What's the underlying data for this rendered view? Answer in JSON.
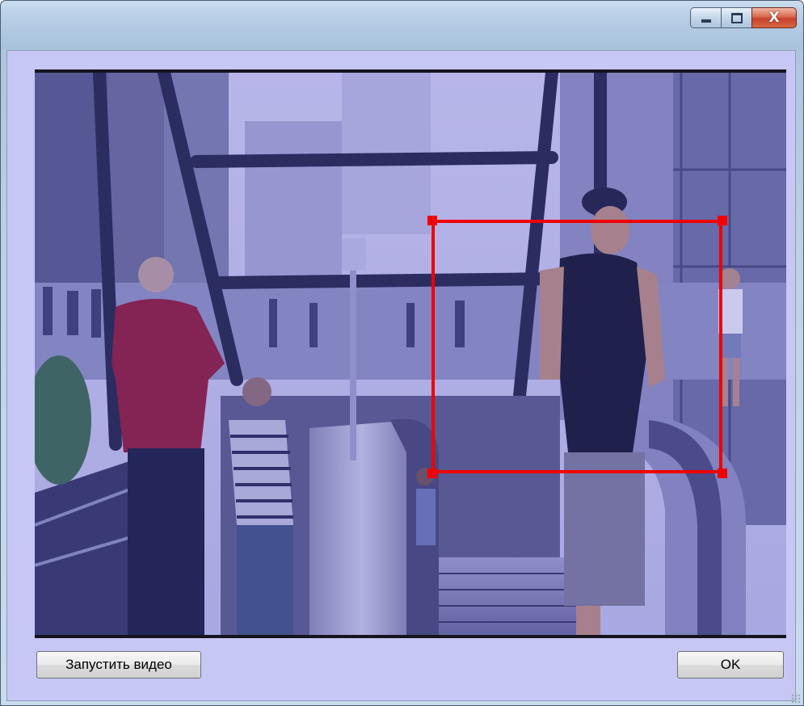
{
  "window": {
    "caption_buttons": {
      "minimize_icon": "minimize-icon",
      "maximize_icon": "maximize-icon",
      "close_glyph": "X"
    }
  },
  "video": {
    "overlay_tint": "#3c3cc8",
    "roi_color": "#f00000"
  },
  "buttons": {
    "start_video_label": "Запустить видео",
    "ok_label": "OK"
  }
}
